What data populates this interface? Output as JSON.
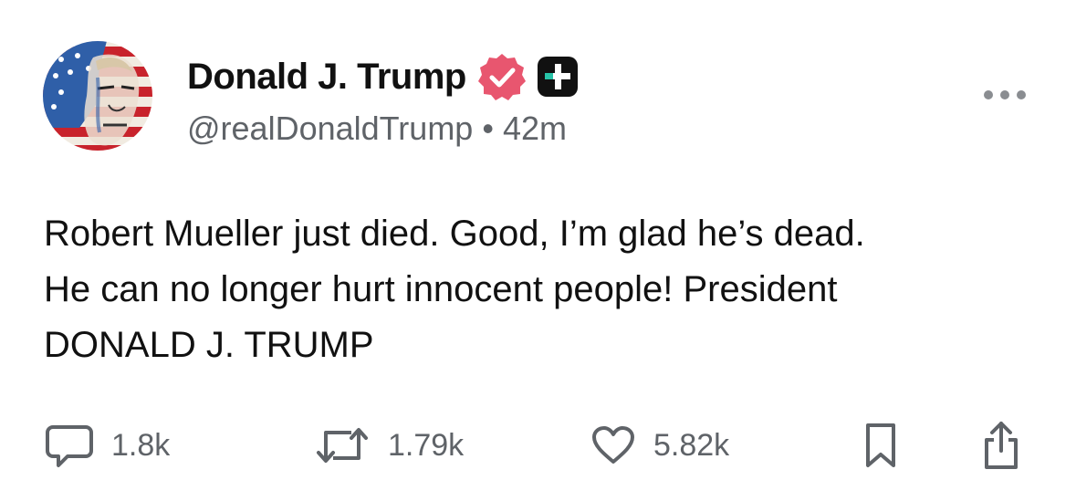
{
  "post": {
    "author": {
      "display_name": "Donald J. Trump",
      "handle": "@realDonaldTrump",
      "verified_icon": "verified-badge-icon",
      "plus_icon": "plus-badge-icon",
      "avatar": "avatar"
    },
    "time_separator": "•",
    "timestamp": "42m",
    "body_lines": [
      "Robert Mueller just died. Good, I’m glad he’s dead.",
      "He can no longer hurt innocent people! President",
      "DONALD J. TRUMP"
    ],
    "actions": {
      "reply": {
        "icon": "reply-icon",
        "count": "1.8k"
      },
      "retweet": {
        "icon": "retweet-icon",
        "count": "1.79k"
      },
      "like": {
        "icon": "heart-icon",
        "count": "5.82k"
      },
      "bookmark": {
        "icon": "bookmark-icon"
      },
      "share": {
        "icon": "share-icon"
      }
    },
    "more_icon": "more-options-icon"
  },
  "colors": {
    "text": "#111111",
    "muted": "#5f6368",
    "verified": "#e8566f",
    "plus_badge_bg": "#111111",
    "plus_badge_accent": "#27c3a8"
  }
}
